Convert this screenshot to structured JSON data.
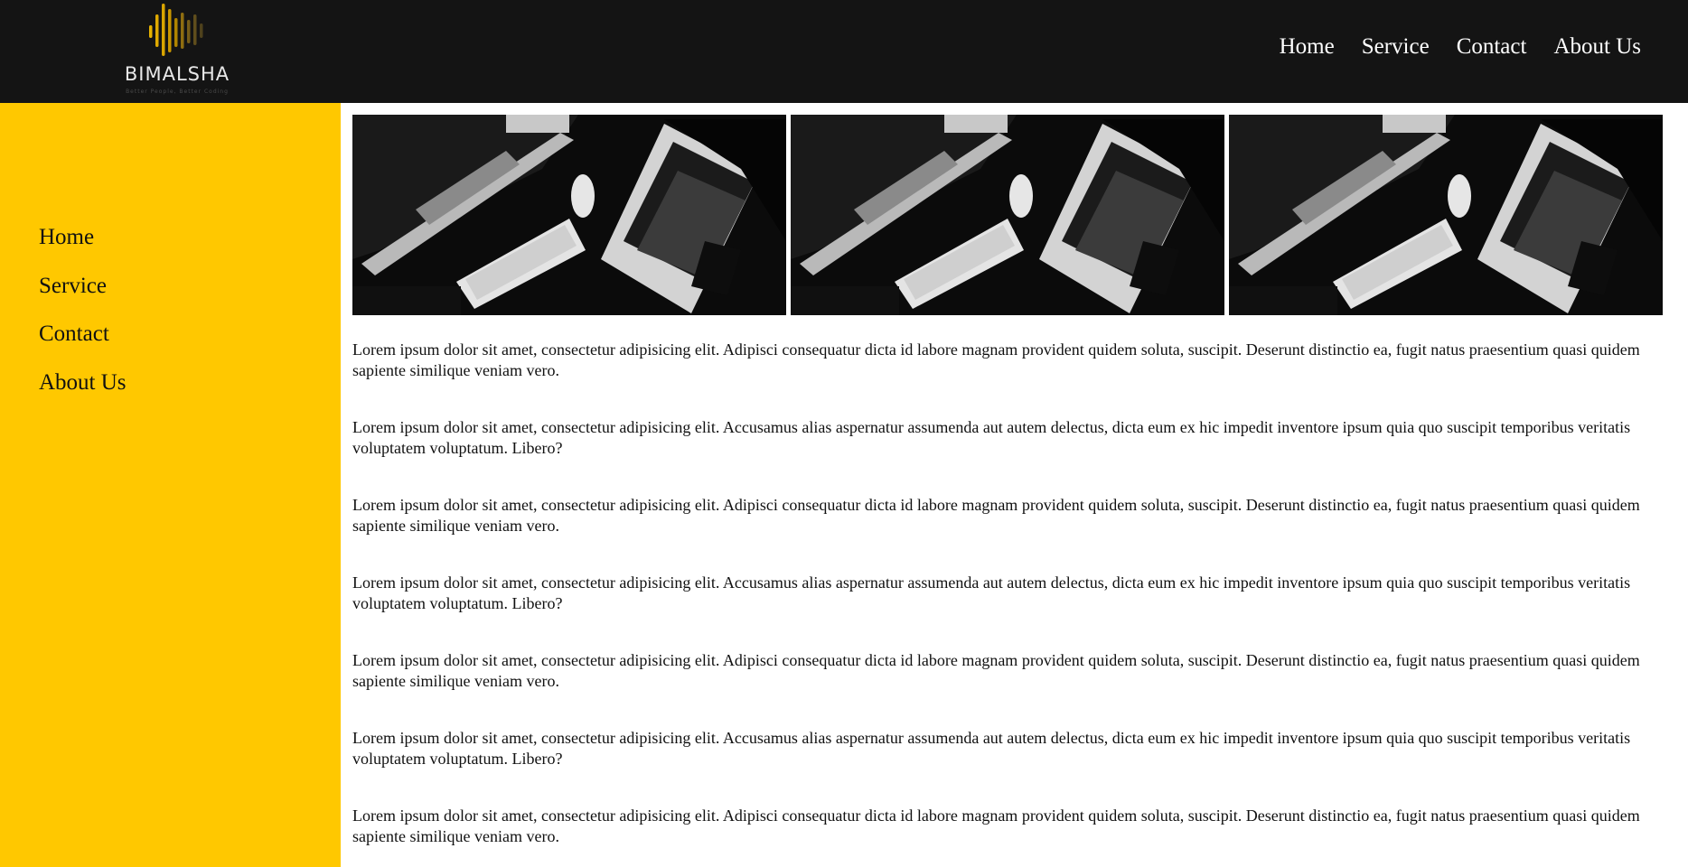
{
  "brand": {
    "name": "BIMALSHA",
    "tagline": "Better People, Better Coding",
    "accent": "#d9a400"
  },
  "header": {
    "nav": [
      "Home",
      "Service",
      "Contact",
      "About Us"
    ]
  },
  "sidebar": {
    "background": "#ffc800",
    "nav": [
      "Home",
      "Service",
      "Contact",
      "About Us"
    ]
  },
  "main": {
    "paragraphs": [
      "Lorem ipsum dolor sit amet, consectetur adipisicing elit. Adipisci consequatur dicta id labore magnam provident quidem soluta, suscipit. Deserunt distinctio ea, fugit natus praesentium quasi quidem sapiente similique veniam vero.",
      "Lorem ipsum dolor sit amet, consectetur adipisicing elit. Accusamus alias aspernatur assumenda aut autem delectus, dicta eum ex hic impedit inventore ipsum quia quo suscipit temporibus veritatis voluptatem voluptatum. Libero?",
      "Lorem ipsum dolor sit amet, consectetur adipisicing elit. Adipisci consequatur dicta id labore magnam provident quidem soluta, suscipit. Deserunt distinctio ea, fugit natus praesentium quasi quidem sapiente similique veniam vero.",
      "Lorem ipsum dolor sit amet, consectetur adipisicing elit. Accusamus alias aspernatur assumenda aut autem delectus, dicta eum ex hic impedit inventore ipsum quia quo suscipit temporibus veritatis voluptatem voluptatum. Libero?",
      "Lorem ipsum dolor sit amet, consectetur adipisicing elit. Adipisci consequatur dicta id labore magnam provident quidem soluta, suscipit. Deserunt distinctio ea, fugit natus praesentium quasi quidem sapiente similique veniam vero.",
      "Lorem ipsum dolor sit amet, consectetur adipisicing elit. Accusamus alias aspernatur assumenda aut autem delectus, dicta eum ex hic impedit inventore ipsum quia quo suscipit temporibus veritatis voluptatem voluptatum. Libero?",
      "Lorem ipsum dolor sit amet, consectetur adipisicing elit. Adipisci consequatur dicta id labore magnam provident quidem soluta, suscipit. Deserunt distinctio ea, fugit natus praesentium quasi quidem sapiente similique veniam vero."
    ]
  }
}
